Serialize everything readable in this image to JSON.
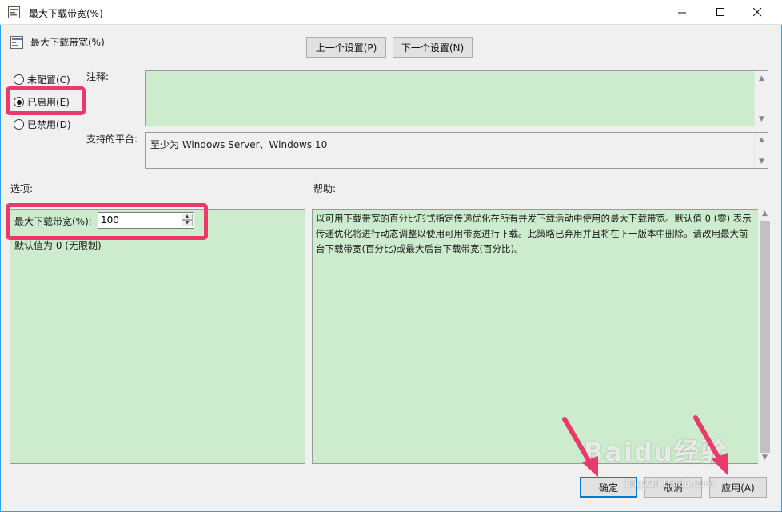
{
  "window": {
    "title": "最大下载带宽(%)",
    "controls": {
      "minimize": "—",
      "maximize": "☐",
      "close": "✕"
    }
  },
  "header": {
    "policy_title": "最大下载带宽(%)",
    "prev_button": "上一个设置(P)",
    "next_button": "下一个设置(N)"
  },
  "state_options": [
    {
      "label": "未配置(C)",
      "checked": false
    },
    {
      "label": "已启用(E)",
      "checked": true
    },
    {
      "label": "已禁用(D)",
      "checked": false
    }
  ],
  "labels": {
    "comment": "注释:",
    "supported_platform": "支持的平台:",
    "options": "选项:",
    "help": "帮助:"
  },
  "comment_value": "",
  "supported_platform_value": "至少为 Windows Server、Windows 10",
  "options": {
    "spin_label": "最大下载带宽(%):",
    "spin_value": "100",
    "default_note": "默认值为 0 (无限制)"
  },
  "help_text": "以可用下载带宽的百分比形式指定传递优化在所有并发下载活动中使用的最大下载带宽。默认值 0 (零) 表示传递优化将进行动态调整以使用可用带宽进行下载。此策略已弃用并且将在下一版本中删除。请改用最大前台下载带宽(百分比)或最大后台下载带宽(百分比)。",
  "footer": {
    "ok": "确定",
    "cancel": "取消",
    "apply": "应用(A)"
  },
  "watermark": {
    "text": "Baidu经验",
    "sub": "jingyan.baidu.com"
  },
  "colors": {
    "panel_green": "#cdeccd",
    "highlight": "#e83a6b",
    "accent": "#0078d7"
  }
}
